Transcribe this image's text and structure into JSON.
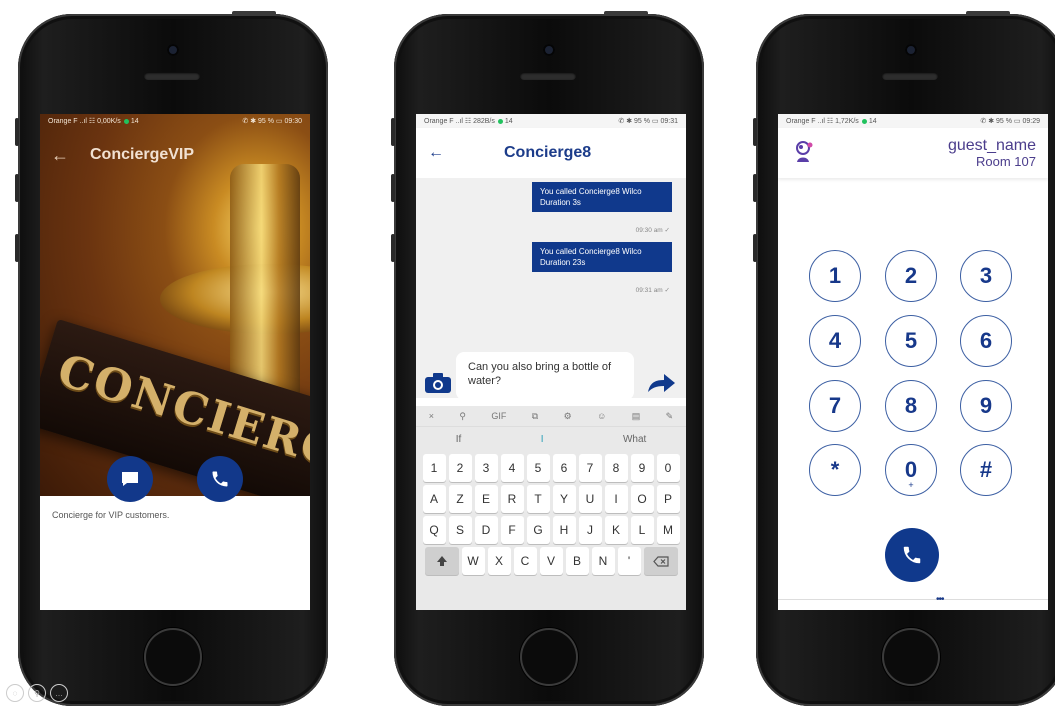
{
  "phone1": {
    "status": {
      "left": "Orange F  ..ıl ☷ 0,00K/s",
      "extra": "14",
      "right": "✆ ✱ 95 % ▭ 09:30"
    },
    "title": "ConciergeVIP",
    "back_glyph": "←",
    "plate_text": "CONCIERG",
    "description": "Concierge for VIP customers.",
    "icons": {
      "chat": "chat-bubble-icon",
      "call": "phone-icon"
    }
  },
  "phone2": {
    "status": {
      "left": "Orange F  ..ıl ☷ 282B/s",
      "extra": "14",
      "right": "✆ ✱ 95 % ▭ 09:31"
    },
    "title": "Concierge8",
    "back_glyph": "←",
    "messages": [
      {
        "line1": "You called Concierge8 Wilco",
        "line2": "Duration 3s",
        "time": "09:30 am"
      },
      {
        "line1": "You called Concierge8 Wilco",
        "line2": "Duration 23s",
        "time": "09:31 am"
      }
    ],
    "input_value": "Can you also bring a bottle of water?",
    "keyboard": {
      "suggestions": [
        "If",
        "I",
        "What"
      ],
      "row1": [
        "1",
        "2",
        "3",
        "4",
        "5",
        "6",
        "7",
        "8",
        "9",
        "0"
      ],
      "row2": [
        "A",
        "Z",
        "E",
        "R",
        "T",
        "Y",
        "U",
        "I",
        "O",
        "P"
      ],
      "row3": [
        "Q",
        "S",
        "D",
        "F",
        "G",
        "H",
        "J",
        "K",
        "L",
        "M"
      ],
      "row4": [
        "W",
        "X",
        "C",
        "V",
        "B",
        "N",
        "'"
      ],
      "toolbar": [
        "×",
        "⚲",
        "GIF",
        "⧉",
        "⚙",
        "☺",
        "▤",
        "✎"
      ]
    }
  },
  "phone3": {
    "status": {
      "left": "Orange F  ..ıl ☷ 1,72K/s",
      "extra": "14",
      "right": "✆ ✱ 95 % ▭ 09:29"
    },
    "guest_name": "guest_name",
    "room": "Room 107",
    "keys": [
      "1",
      "2",
      "3",
      "4",
      "5",
      "6",
      "7",
      "8",
      "9",
      "*",
      "0",
      "#"
    ],
    "zero_sub": "+",
    "more": "•••"
  },
  "colors": {
    "brand": "#10398c",
    "purple": "#4b3d8c"
  }
}
